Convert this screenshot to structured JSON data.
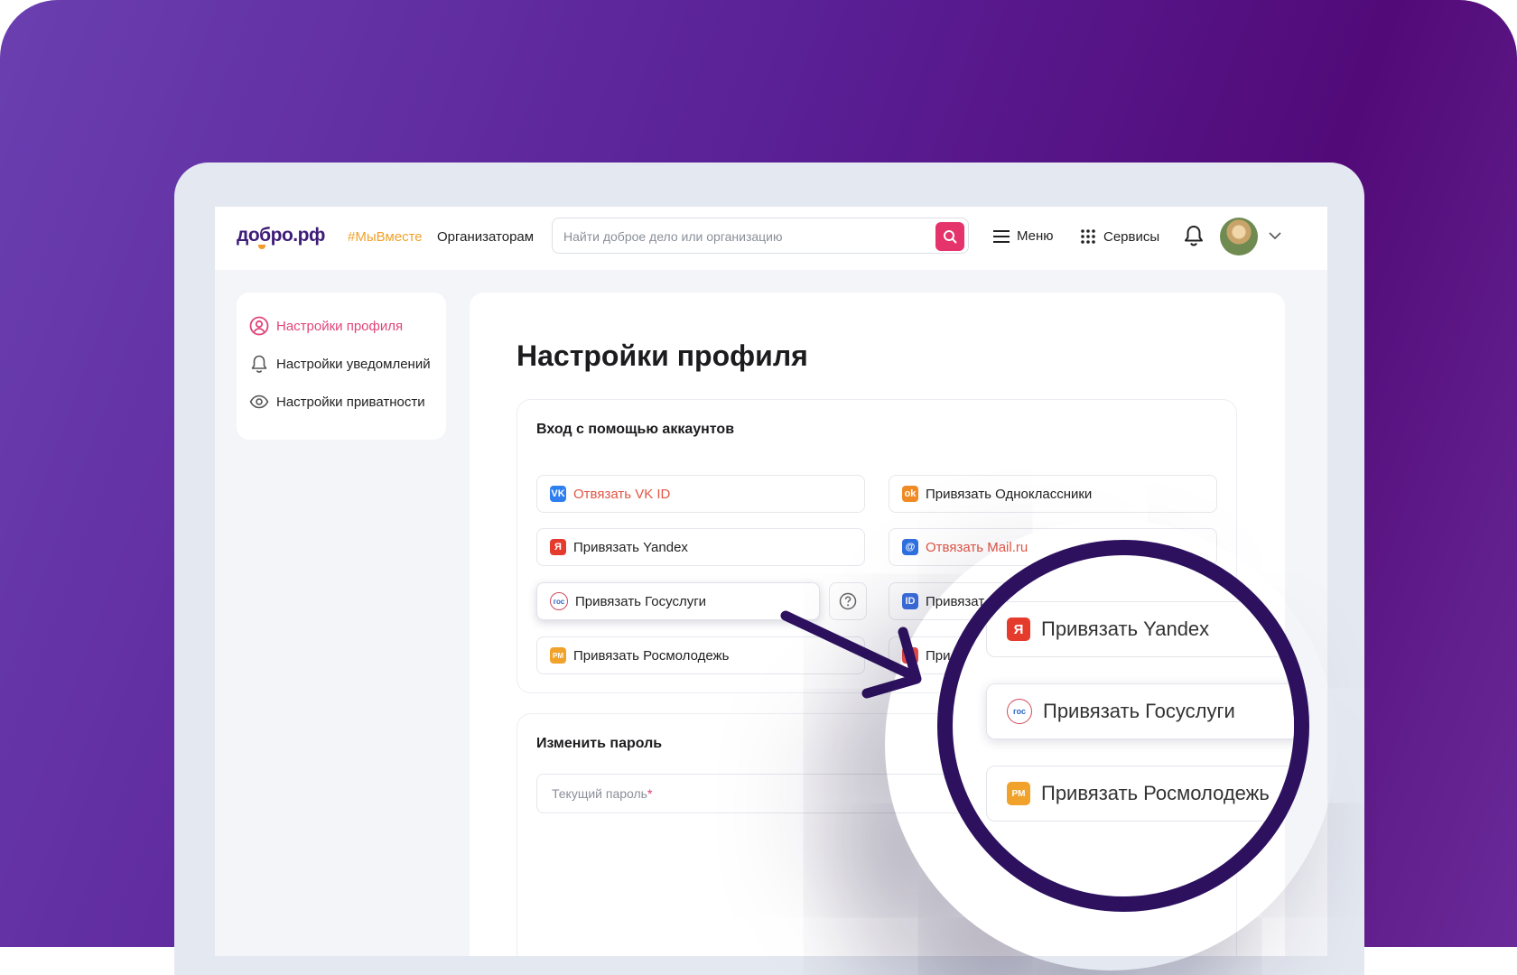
{
  "header": {
    "logo": "добро.рф",
    "hashtag": "#МыВместе",
    "organizers_link": "Организаторам",
    "search_placeholder": "Найти доброе дело или организацию",
    "menu_label": "Меню",
    "services_label": "Сервисы"
  },
  "sidebar": {
    "items": [
      {
        "label": "Настройки профиля",
        "icon": "user-circle-icon",
        "active": true
      },
      {
        "label": "Настройки уведомлений",
        "icon": "bell-icon",
        "active": false
      },
      {
        "label": "Настройки приватности",
        "icon": "eye-icon",
        "active": false
      }
    ]
  },
  "main": {
    "page_title": "Настройки профиля",
    "accounts": {
      "title": "Вход с помощью аккаунтов",
      "buttons": {
        "vk": "Отвязать VK ID",
        "ok": "Привязать Одноклассники",
        "yandex": "Привязать Yandex",
        "mail": "Отвязать Mail.ru",
        "gosuslugi": "Привязать Госуслуги",
        "id_partial": "Привязат",
        "rosmolodezh": "Привязать Росмолодежь",
        "last_partial": "При"
      }
    },
    "password": {
      "title": "Изменить пароль",
      "current_label": "Текущий пароль",
      "required_mark": "*"
    }
  },
  "magnifier": {
    "items": [
      {
        "label": "Привязать Yandex",
        "icon": "yandex-icon"
      },
      {
        "label": "Привязать Госуслуги",
        "icon": "gosuslugi-icon"
      },
      {
        "label": "Привязать Росмолодежь",
        "icon": "rosmolodezh-icon"
      }
    ]
  },
  "colors": {
    "accent": "#e5336b",
    "brand": "#3e1d78",
    "unlink_red": "#e25545",
    "background_purple": "#5a1f95"
  }
}
